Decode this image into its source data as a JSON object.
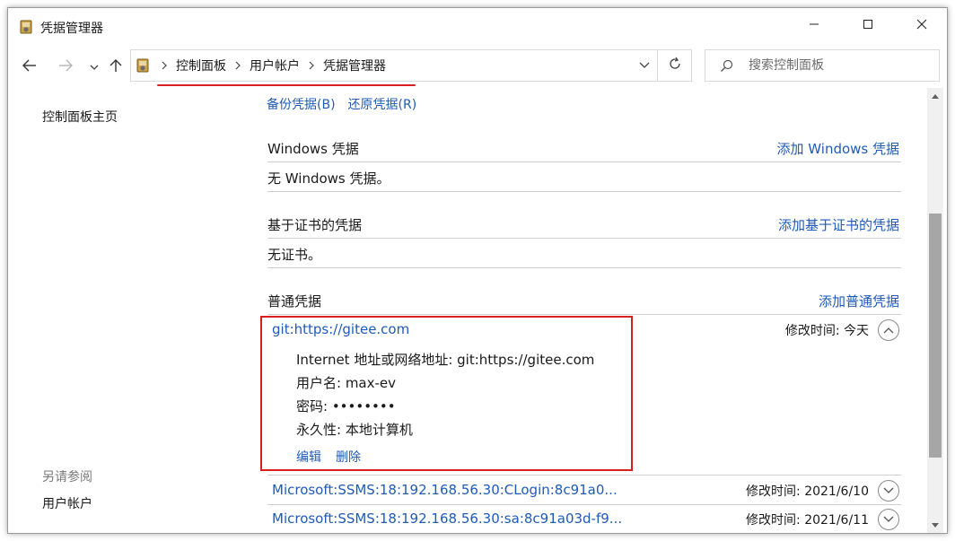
{
  "window": {
    "title": "凭据管理器"
  },
  "address": {
    "breadcrumbs": [
      "控制面板",
      "用户帐户",
      "凭据管理器"
    ]
  },
  "search": {
    "placeholder": "搜索控制面板"
  },
  "left_pane": {
    "home": "控制面板主页",
    "see_also": "另请参阅",
    "user_accounts": "用户帐户"
  },
  "toolbar": {
    "backup": "备份凭据(B)",
    "restore": "还原凭据(R)"
  },
  "sections": {
    "windows": {
      "title": "Windows 凭据",
      "add": "添加 Windows 凭据",
      "empty": "无 Windows 凭据。"
    },
    "certificate": {
      "title": "基于证书的凭据",
      "add": "添加基于证书的凭据",
      "empty": "无证书。"
    },
    "generic": {
      "title": "普通凭据",
      "add": "添加普通凭据",
      "items": [
        {
          "name": "git:https://gitee.com",
          "modified": "修改时间:  今天",
          "expanded": true,
          "details": {
            "address": "Internet 地址或网络地址:  git:https://gitee.com",
            "username": "用户名:  max-ev",
            "password": "密码:  ••••••••",
            "persistence": "永久性:  本地计算机"
          },
          "edit": "编辑",
          "remove": "删除"
        },
        {
          "name": "Microsoft:SSMS:18:192.168.56.30:CLogin:8c91a0...",
          "modified": "修改时间:  2021/6/10",
          "expanded": false
        },
        {
          "name": "Microsoft:SSMS:18:192.168.56.30:sa:8c91a03d-f9...",
          "modified": "修改时间:  2021/6/11",
          "expanded": false
        }
      ]
    }
  },
  "colors": {
    "link": "#1f5bb7",
    "annotation": "#d82020",
    "scroll_thumb": "#a6a6a6"
  },
  "icons": [
    "credential-manager-icon",
    "minimize-icon",
    "maximize-icon",
    "close-icon",
    "back-arrow-icon",
    "forward-arrow-icon",
    "chevron-down-icon",
    "up-arrow-icon",
    "chevron-right-icon",
    "refresh-icon",
    "search-icon",
    "chevron-up-icon",
    "scroll-up-icon",
    "scroll-down-icon"
  ]
}
